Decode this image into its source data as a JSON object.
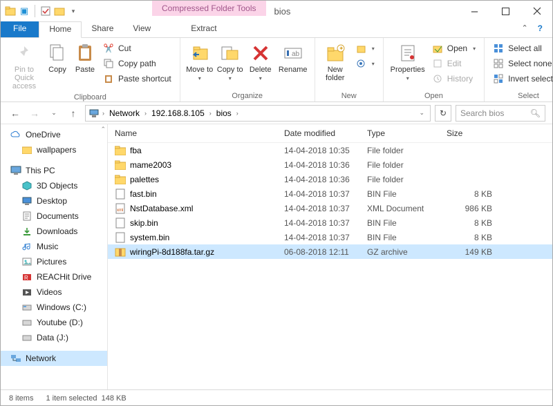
{
  "window": {
    "title": "bios",
    "context_tab": "Compressed Folder Tools"
  },
  "tabs": {
    "file": "File",
    "home": "Home",
    "share": "Share",
    "view": "View",
    "extract": "Extract"
  },
  "ribbon": {
    "clipboard": {
      "label": "Clipboard",
      "pin": "Pin to Quick access",
      "copy": "Copy",
      "paste": "Paste",
      "cut": "Cut",
      "copy_path": "Copy path",
      "paste_shortcut": "Paste shortcut"
    },
    "organize": {
      "label": "Organize",
      "move": "Move to",
      "copy": "Copy to",
      "delete": "Delete",
      "rename": "Rename"
    },
    "new": {
      "label": "New",
      "new_folder": "New folder"
    },
    "open": {
      "label": "Open",
      "properties": "Properties",
      "open": "Open",
      "edit": "Edit",
      "history": "History"
    },
    "select": {
      "label": "Select",
      "all": "Select all",
      "none": "Select none",
      "invert": "Invert selection"
    }
  },
  "address": {
    "crumbs": [
      "Network",
      "192.168.8.105",
      "bios"
    ],
    "search_placeholder": "Search bios"
  },
  "tree": {
    "onedrive": "OneDrive",
    "wallpapers": "wallpapers",
    "thispc": "This PC",
    "items": [
      "3D Objects",
      "Desktop",
      "Documents",
      "Downloads",
      "Music",
      "Pictures",
      "REACHit Drive",
      "Videos",
      "Windows (C:)",
      "Youtube (D:)",
      "Data (J:)"
    ],
    "network": "Network"
  },
  "columns": {
    "name": "Name",
    "date": "Date modified",
    "type": "Type",
    "size": "Size"
  },
  "files": [
    {
      "name": "fba",
      "date": "14-04-2018 10:35",
      "type": "File folder",
      "size": "",
      "kind": "folder"
    },
    {
      "name": "mame2003",
      "date": "14-04-2018 10:36",
      "type": "File folder",
      "size": "",
      "kind": "folder"
    },
    {
      "name": "palettes",
      "date": "14-04-2018 10:36",
      "type": "File folder",
      "size": "",
      "kind": "folder"
    },
    {
      "name": "fast.bin",
      "date": "14-04-2018 10:37",
      "type": "BIN File",
      "size": "8 KB",
      "kind": "bin"
    },
    {
      "name": "NstDatabase.xml",
      "date": "14-04-2018 10:37",
      "type": "XML Document",
      "size": "986 KB",
      "kind": "xml"
    },
    {
      "name": "skip.bin",
      "date": "14-04-2018 10:37",
      "type": "BIN File",
      "size": "8 KB",
      "kind": "bin"
    },
    {
      "name": "system.bin",
      "date": "14-04-2018 10:37",
      "type": "BIN File",
      "size": "8 KB",
      "kind": "bin"
    },
    {
      "name": "wiringPi-8d188fa.tar.gz",
      "date": "06-08-2018 12:11",
      "type": "GZ archive",
      "size": "149 KB",
      "kind": "gz",
      "selected": true
    }
  ],
  "status": {
    "items": "8 items",
    "selected": "1 item selected",
    "size": "148 KB"
  }
}
